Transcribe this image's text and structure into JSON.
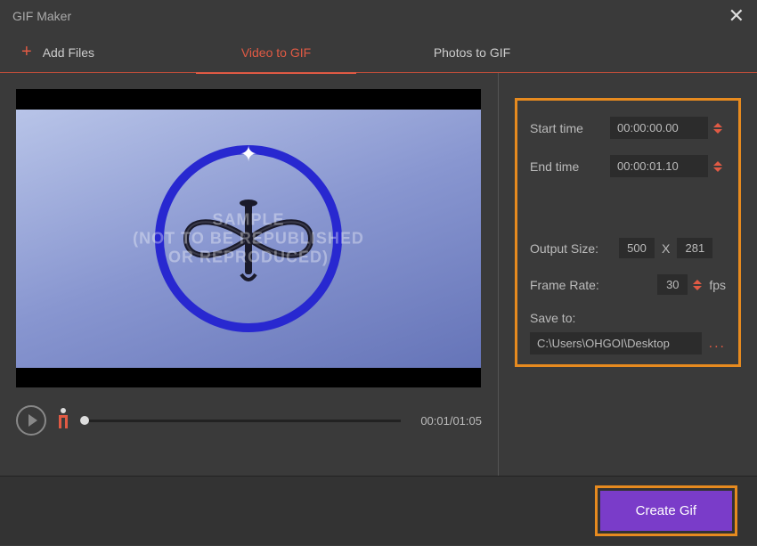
{
  "titlebar": {
    "title": "GIF Maker"
  },
  "tabs": {
    "add_files": "Add Files",
    "video_to_gif": "Video to GIF",
    "photos_to_gif": "Photos to GIF"
  },
  "preview": {
    "watermark_line1": "SAMPLE",
    "watermark_line2": "(NOT TO BE REPUBLISHED",
    "watermark_line3": "OR REPRODUCED)",
    "timecode": "00:01/01:05"
  },
  "settings": {
    "start_time_label": "Start time",
    "start_time_value": "00:00:00.00",
    "end_time_label": "End time",
    "end_time_value": "00:00:01.10",
    "output_size_label": "Output Size:",
    "output_width": "500",
    "output_height": "281",
    "size_x": "X",
    "frame_rate_label": "Frame Rate:",
    "frame_rate_value": "30",
    "fps_unit": "fps",
    "save_to_label": "Save to:",
    "save_path": "C:\\Users\\OHGOI\\Desktop",
    "browse": "..."
  },
  "footer": {
    "create_gif": "Create Gif"
  }
}
